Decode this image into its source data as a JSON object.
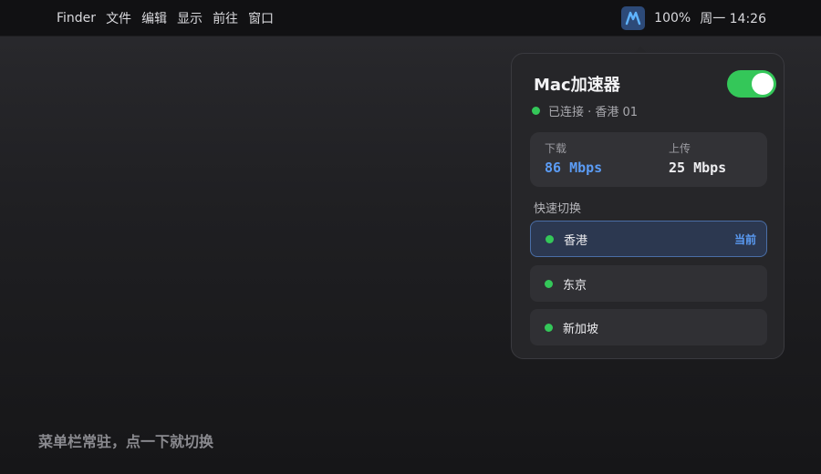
{
  "menubar": {
    "items": [
      "Finder",
      "文件",
      "编辑",
      "显示",
      "前往",
      "窗口"
    ],
    "app_icon": "accelerator-logo-icon",
    "battery": "100%",
    "clock": "周一 14:26"
  },
  "panel": {
    "title": "Mac加速器",
    "toggle_on": true,
    "status": "已连接 · 香港 01",
    "download_label": "下载",
    "download_value": "86 Mbps",
    "upload_label": "上传",
    "upload_value": "25 Mbps",
    "quick_switch_label": "快速切换",
    "servers": [
      {
        "name": "香港",
        "tag": "当前"
      },
      {
        "name": "东京",
        "tag": ""
      },
      {
        "name": "新加坡",
        "tag": ""
      }
    ]
  },
  "caption": "菜单栏常驻，点一下就切换",
  "colors": {
    "accent_blue": "#5b9cf5",
    "status_green": "#34c759",
    "panel_bg": "#262629"
  }
}
